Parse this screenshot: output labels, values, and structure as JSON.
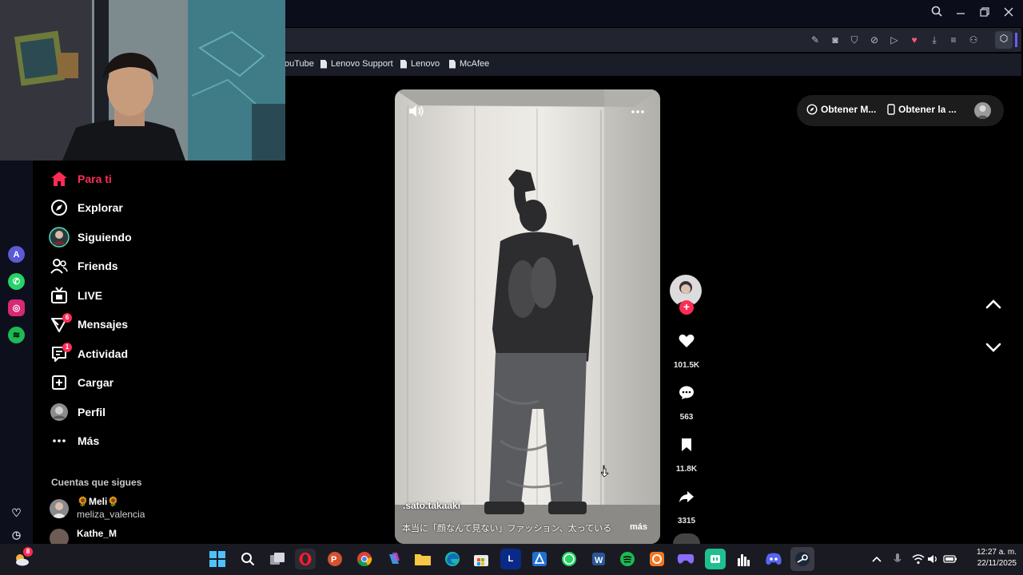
{
  "bookmarks": [
    "ouTube",
    "Lenovo Support",
    "Lenovo",
    "McAfee"
  ],
  "nav": {
    "para_ti": "Para ti",
    "explorar": "Explorar",
    "siguiendo": "Siguiendo",
    "friends": "Friends",
    "live": "LIVE",
    "mensajes": "Mensajes",
    "mensajes_badge": "6",
    "actividad": "Actividad",
    "actividad_badge": "1",
    "cargar": "Cargar",
    "perfil": "Perfil",
    "mas": "Más"
  },
  "following": {
    "heading": "Cuentas que sigues",
    "accounts": [
      {
        "display": "🌻Meli🌻",
        "handle": "meliza_valencia"
      },
      {
        "display": "Kathe_M",
        "handle": ""
      }
    ]
  },
  "video": {
    "username": ".sato.takaaki",
    "caption": "本当に「顔なんて見ない」ファッション、太っている",
    "more": "más"
  },
  "actions": {
    "likes": "101.5K",
    "comments": "563",
    "saves": "11.8K",
    "shares": "3315"
  },
  "top_right": {
    "get_app1": "Obtener M...",
    "get_app2": "Obtener la ..."
  },
  "taskbar": {
    "time": "12:27 a. m.",
    "date": "22/11/2025",
    "notification_badge": "8"
  },
  "colors": {
    "accent": "#fe2c55",
    "sidebar": "#0d0f1d",
    "titlebar": "#0b0d1a"
  }
}
